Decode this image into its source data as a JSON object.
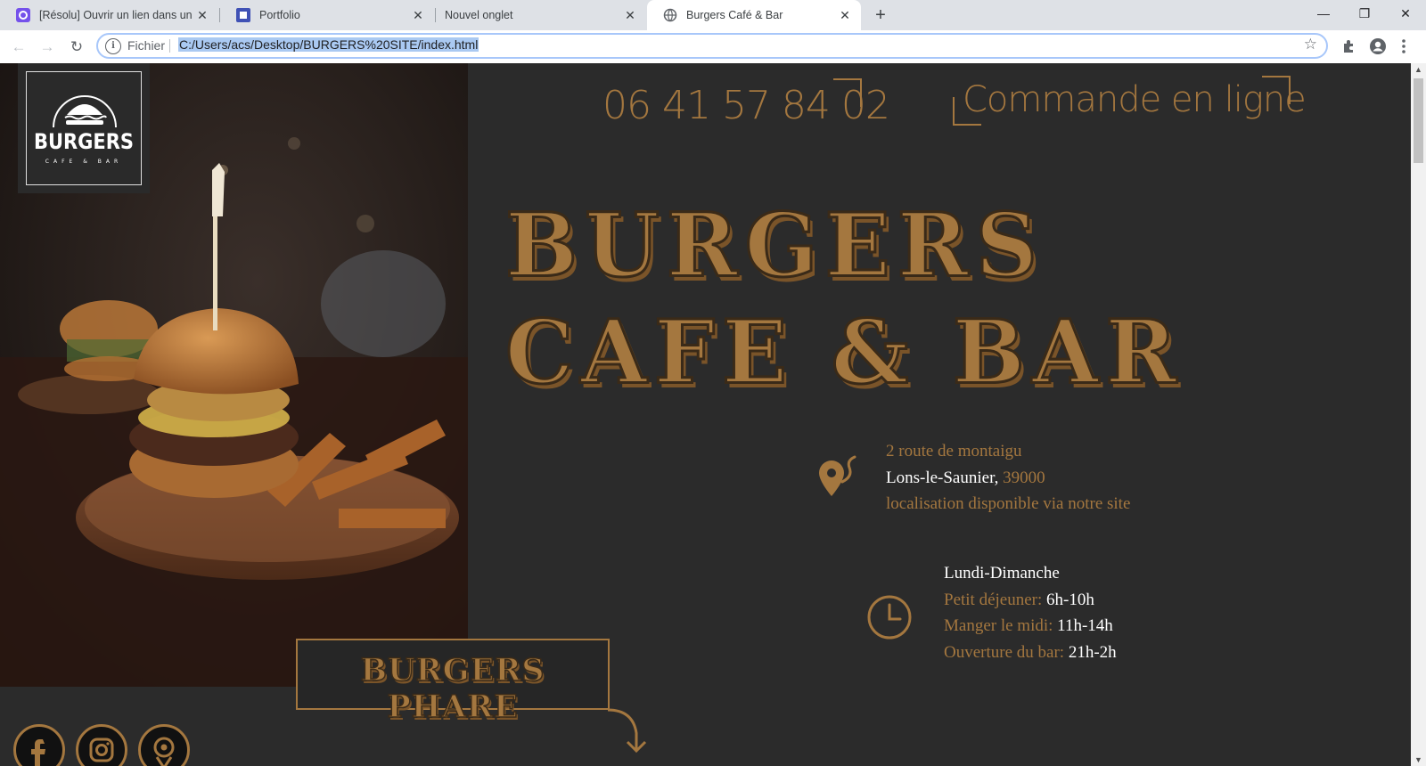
{
  "browser": {
    "tabs": [
      {
        "title": "[Résolu] Ouvrir un lien dans un n",
        "icon": "openclassrooms-icon",
        "active": false
      },
      {
        "title": "Portfolio",
        "icon": "portfolio-icon",
        "active": false
      },
      {
        "title": "Nouvel onglet",
        "icon": "",
        "active": false
      },
      {
        "title": "Burgers Café & Bar",
        "icon": "globe-icon",
        "active": true
      }
    ],
    "new_tab": "+",
    "window_controls": {
      "minimize": "—",
      "restore": "❐",
      "close": "✕"
    },
    "address": {
      "scheme_label": "Fichier",
      "url": "C:/Users/acs/Desktop/BURGERS%20SITE/index.html"
    }
  },
  "page": {
    "logo": {
      "main": "BURGERS",
      "sub": "CAFE & BAR"
    },
    "phone": "06 41 57 84 02",
    "order_link": "Commande en ligne",
    "title_line1": "BURGERS",
    "title_line2": "CAFE & BAR",
    "address": {
      "line1": "2 route de montaigu",
      "city": "Lons-le-Saunier,",
      "postcode": "39000",
      "line3": "localisation disponible via notre site"
    },
    "hours": {
      "days": "Lundi-Dimanche",
      "rows": [
        {
          "label": "Petit déjeuner:",
          "value": "6h-10h"
        },
        {
          "label": "Manger le midi:",
          "value": "11h-14h"
        },
        {
          "label": "Ouverture du bar:",
          "value": "21h-2h"
        }
      ]
    },
    "featured_button": "BURGERS PHARE",
    "social": [
      "facebook-icon",
      "instagram-icon",
      "location-icon"
    ]
  },
  "colors": {
    "accent": "#a4773f",
    "background": "#2b2b2b"
  }
}
